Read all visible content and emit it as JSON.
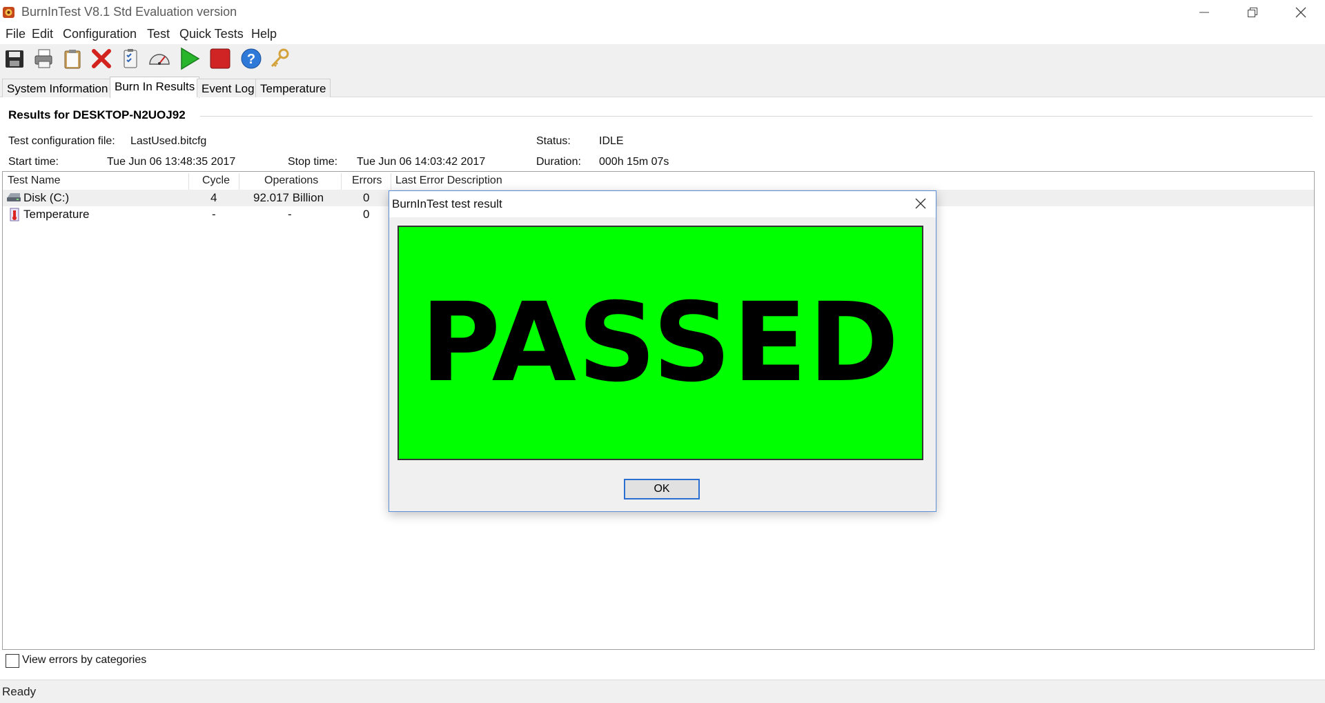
{
  "window": {
    "title": "BurnInTest V8.1 Std Evaluation version",
    "icon": "burnintest-app-icon"
  },
  "menu": [
    "File",
    "Edit",
    "Configuration",
    "Test",
    "Quick Tests",
    "Help"
  ],
  "toolbar": [
    "save-icon",
    "printer-icon",
    "clipboard-icon",
    "delete-x-icon",
    "checklist-icon",
    "gauge-icon",
    "play-icon",
    "stop-icon",
    "help-icon",
    "key-icon"
  ],
  "tabs": [
    "System Information",
    "Burn In Results",
    "Event Log",
    "Temperature"
  ],
  "results": {
    "title": "Results for DESKTOP-N2UOJ92",
    "config_label": "Test configuration file:",
    "config_value": "LastUsed.bitcfg",
    "status_label": "Status:",
    "status_value": "IDLE",
    "start_label": "Start time:",
    "start_value": "Tue Jun 06 13:48:35 2017",
    "stop_label": "Stop time:",
    "stop_value": "Tue Jun 06 14:03:42 2017",
    "duration_label": "Duration:",
    "duration_value": "000h 15m 07s"
  },
  "table": {
    "columns": [
      "Test Name",
      "Cycle",
      "Operations",
      "Errors",
      "Last Error Description"
    ],
    "rows": [
      {
        "name": "Disk (C:)",
        "cycle": "4",
        "operations": "92.017 Billion",
        "errors": "0",
        "last_error": "",
        "icon": "disk-drive-icon"
      },
      {
        "name": "Temperature",
        "cycle": "-",
        "operations": "-",
        "errors": "0",
        "last_error": "",
        "icon": "thermometer-icon"
      }
    ]
  },
  "footer": {
    "checkbox_label": "View errors by categories",
    "checkbox_checked": false
  },
  "statusbar": {
    "text": "Ready"
  },
  "dialog": {
    "title": "BurnInTest test result",
    "result": "PASSED",
    "ok_label": "OK",
    "result_color": "#00ff00"
  }
}
